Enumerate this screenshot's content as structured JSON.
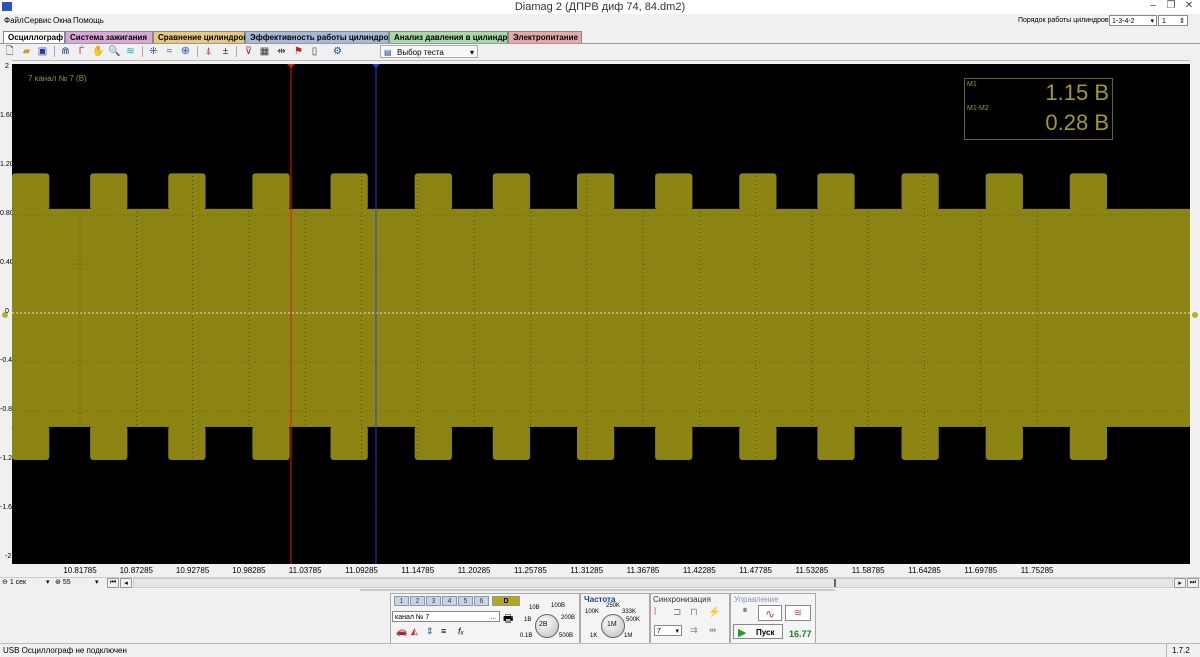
{
  "window": {
    "title": "Diamag 2 (ДПРВ диф 74, 84.dm2)",
    "cyl_order_label": "Порядок работы цилиндров",
    "cyl_order_value": "1-3-4-2",
    "cyl_spin_value": "1"
  },
  "menu": [
    "Файл",
    "Сервис",
    "Окна",
    "Помощь"
  ],
  "tabs": [
    {
      "label": "Осциллограф",
      "color": "#ffffff"
    },
    {
      "label": "Система зажигания",
      "color": "#d8a8d8"
    },
    {
      "label": "Сравнение цилиндров",
      "color": "#e8c87a"
    },
    {
      "label": "Эффективность работы цилиндров",
      "color": "#a8b8d8"
    },
    {
      "label": "Анализ давления в цилиндре",
      "color": "#a8d8a8"
    },
    {
      "label": "Электропитание",
      "color": "#e8a8a8"
    }
  ],
  "toolbar": {
    "test_select": "Выбор теста"
  },
  "scope": {
    "channel_label": "7 канал № 7 (В)",
    "trace_color": "#8c8514",
    "marker1_label": "M1",
    "marker1_value": "1.15 В",
    "marker_diff_label": "M1-M2",
    "marker_diff_value": "0.28 В",
    "y_ticks": [
      "2",
      "1.60",
      "1.20",
      "0.80",
      "0.40",
      "0",
      "-0.40",
      "-0.80",
      "-1.20",
      "-1.60",
      "-2"
    ],
    "x_ticks": [
      "10.81785",
      "10.87285",
      "10.92785",
      "10.98285",
      "11.03785",
      "11.09285",
      "11.14785",
      "11.20285",
      "11.25785",
      "11.31285",
      "11.36785",
      "11.42285",
      "11.47785",
      "11.53285",
      "11.58785",
      "11.64285",
      "11.69785",
      "11.75285"
    ]
  },
  "chart_data": {
    "type": "line",
    "series": [
      {
        "upper_envelope": [
          1.14,
          0.85
        ],
        "lower_envelope": [
          -1.2,
          -0.93
        ]
      }
    ],
    "ylim": [
      -2,
      2
    ],
    "x_range": [
      10.79,
      11.77
    ],
    "high_segments_start": [
      10.79,
      10.855,
      10.92,
      10.99,
      11.055,
      11.125,
      11.19,
      11.26,
      11.325,
      11.395,
      11.46,
      11.53,
      11.6,
      11.67
    ],
    "segment_length": 0.031
  },
  "timebase": {
    "value": "1 сек",
    "zoom": "55"
  },
  "control": {
    "channels": [
      "1",
      "2",
      "3",
      "4",
      "5",
      "6",
      "D"
    ],
    "channel_name": "канал № 7",
    "volt_knob": "2В",
    "volt_ticks": [
      "10В",
      "100В",
      "1В",
      "200В",
      "0.1В",
      "500В"
    ],
    "freq_title": "Частота",
    "freq_knob": "1M",
    "freq_ticks": [
      "250K",
      "100K",
      "333K",
      "500K",
      "1K",
      "1M"
    ],
    "sync_title": "Синхронизация",
    "sync_channel": "7",
    "mgmt_title": "Управление",
    "start_label": "Пуск",
    "counter": "16.77"
  },
  "status": {
    "left": "USB Осциллограф не подключен",
    "version": "1.7.2"
  }
}
